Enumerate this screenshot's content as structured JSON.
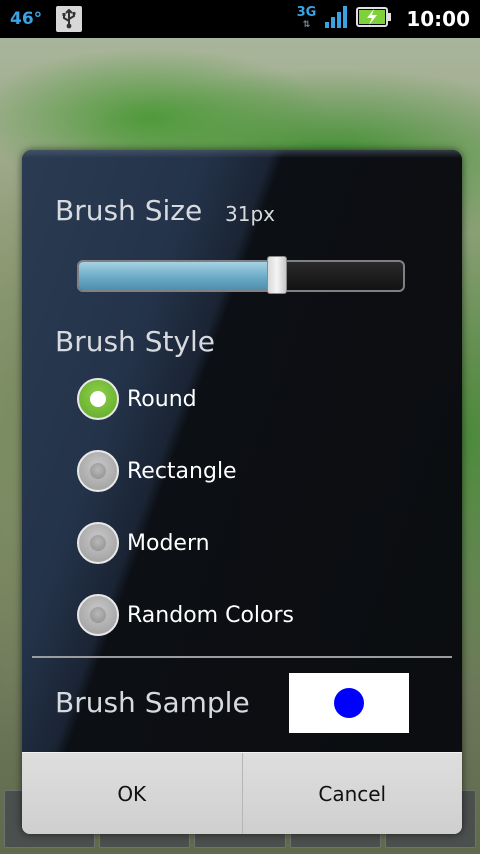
{
  "status_bar": {
    "temperature": "46°",
    "network_type": "3G",
    "time": "10:00",
    "accent_color": "#3aa3e3"
  },
  "dialog": {
    "brush_size": {
      "label": "Brush Size",
      "value_text": "31px",
      "slider_fraction": 0.61
    },
    "brush_style": {
      "label": "Brush Style",
      "options": [
        {
          "label": "Round",
          "checked": true
        },
        {
          "label": "Rectangle",
          "checked": false
        },
        {
          "label": "Modern",
          "checked": false
        },
        {
          "label": "Random Colors",
          "checked": false
        }
      ]
    },
    "brush_sample": {
      "label": "Brush Sample",
      "sample_color": "#0000ff"
    },
    "buttons": {
      "ok": "OK",
      "cancel": "Cancel"
    }
  }
}
